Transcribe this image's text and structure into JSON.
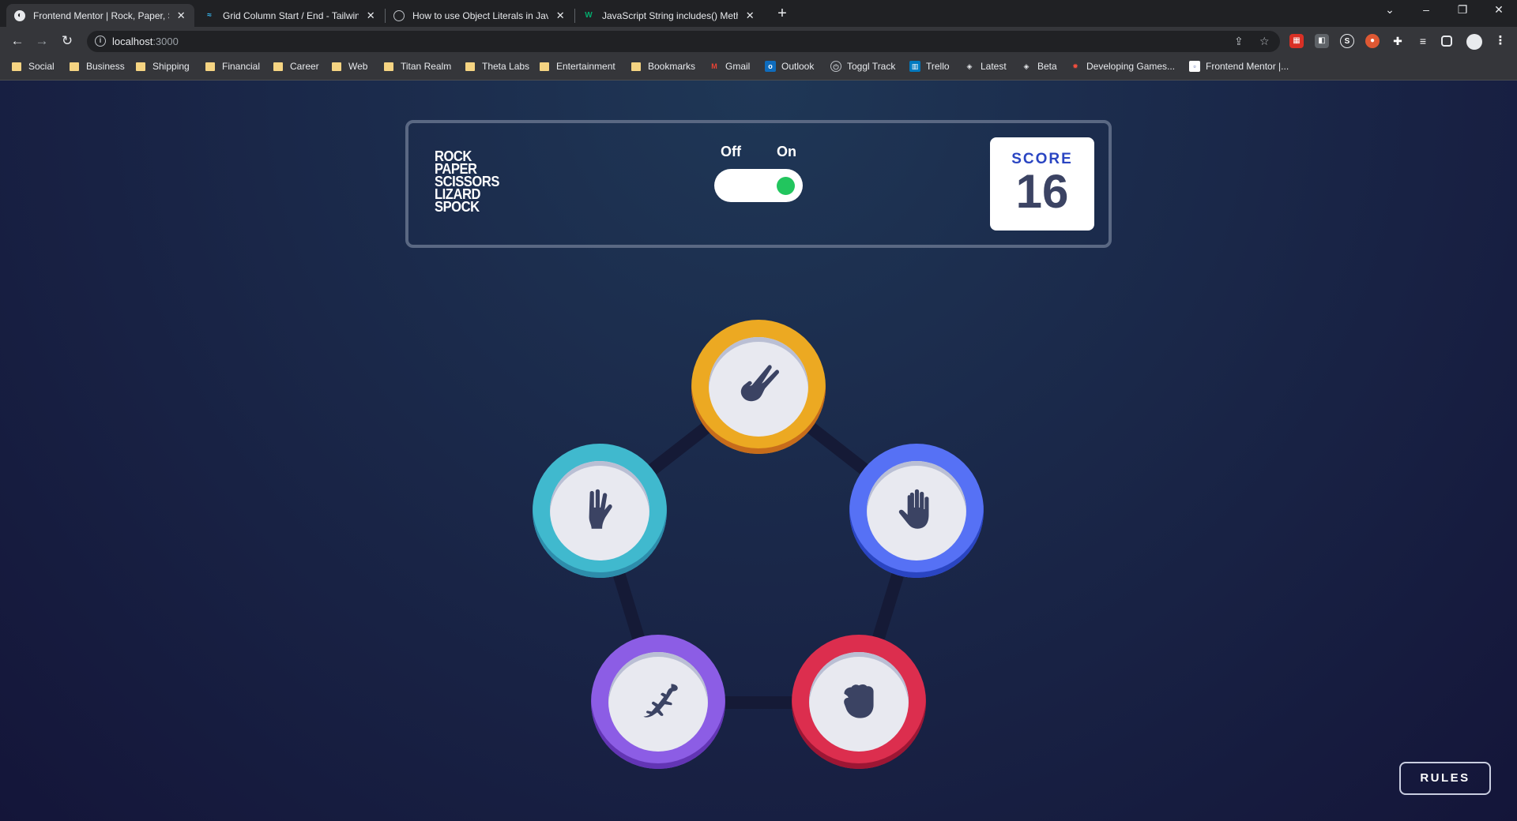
{
  "browser": {
    "tabs": [
      {
        "title": "Frontend Mentor | Rock, Paper, Scissors",
        "favicon": "frontend-mentor-icon",
        "active": true
      },
      {
        "title": "Grid Column Start / End - Tailwind CSS",
        "favicon": "tailwind-icon",
        "active": false
      },
      {
        "title": "How to use Object Literals in JavaScript",
        "favicon": "globe-icon",
        "active": false
      },
      {
        "title": "JavaScript String includes() Method",
        "favicon": "w3schools-icon",
        "active": false
      }
    ],
    "url_host": "localhost",
    "url_port": ":3000",
    "bookmarks": [
      {
        "label": "Social",
        "type": "folder"
      },
      {
        "label": "Business",
        "type": "folder"
      },
      {
        "label": "Shipping",
        "type": "folder"
      },
      {
        "label": "Financial",
        "type": "folder"
      },
      {
        "label": "Career",
        "type": "folder"
      },
      {
        "label": "Web",
        "type": "folder"
      },
      {
        "label": "Titan Realm",
        "type": "folder"
      },
      {
        "label": "Theta Labs",
        "type": "folder"
      },
      {
        "label": "Entertainment",
        "type": "folder"
      },
      {
        "label": "Bookmarks",
        "type": "folder"
      },
      {
        "label": "Gmail",
        "type": "link"
      },
      {
        "label": "Outlook",
        "type": "link"
      },
      {
        "label": "Toggl Track",
        "type": "link"
      },
      {
        "label": "Trello",
        "type": "link"
      },
      {
        "label": "Latest",
        "type": "link"
      },
      {
        "label": "Beta",
        "type": "link"
      },
      {
        "label": "Developing Games...",
        "type": "link"
      },
      {
        "label": "Frontend Mentor |...",
        "type": "link"
      }
    ]
  },
  "game": {
    "logo": [
      "ROCK",
      "PAPER",
      "SCISSORS",
      "LIZARD",
      "SPOCK"
    ],
    "toggle": {
      "off_label": "Off",
      "on_label": "On",
      "state": "on"
    },
    "score": {
      "label": "SCORE",
      "value": "16"
    },
    "choices": [
      {
        "name": "scissors",
        "color": "#eca922",
        "dark": "#c76c1b"
      },
      {
        "name": "spock",
        "color": "#40b9ce",
        "dark": "#2d8dab"
      },
      {
        "name": "paper",
        "color": "#5671f5",
        "dark": "#2a45c2"
      },
      {
        "name": "lizard",
        "color": "#8c5de5",
        "dark": "#6335b5"
      },
      {
        "name": "rock",
        "color": "#dc2e4e",
        "dark": "#9d1634"
      }
    ],
    "rules_label": "RULES"
  },
  "colors": {
    "background_top": "#1f3756",
    "background_bottom": "#141539",
    "header_outline": "#5a6883",
    "score_text": "#2a45c2",
    "toggle_on": "#22c55e"
  }
}
